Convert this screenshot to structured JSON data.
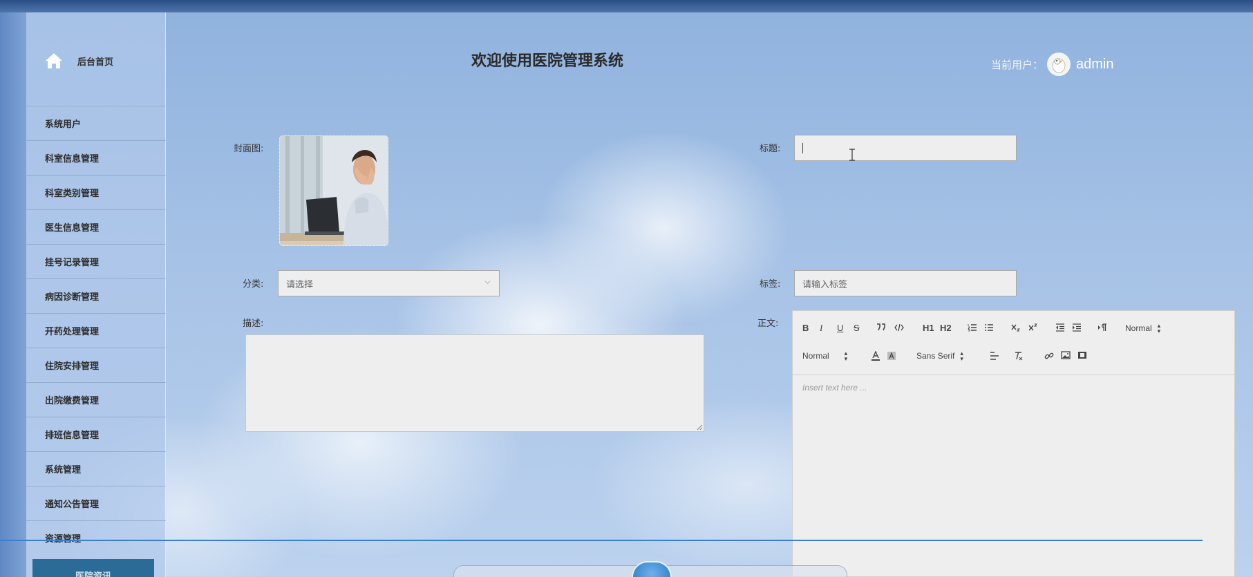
{
  "sidebar": {
    "home_label": "后台首页",
    "items": [
      {
        "label": "系统用户"
      },
      {
        "label": "科室信息管理"
      },
      {
        "label": "科室类别管理"
      },
      {
        "label": "医生信息管理"
      },
      {
        "label": "挂号记录管理"
      },
      {
        "label": "病因诊断管理"
      },
      {
        "label": "开药处理管理"
      },
      {
        "label": "住院安排管理"
      },
      {
        "label": "出院缴费管理"
      },
      {
        "label": "排班信息管理"
      },
      {
        "label": "系统管理"
      },
      {
        "label": "通知公告管理"
      },
      {
        "label": "资源管理"
      }
    ],
    "bottom_button": "医院资讯"
  },
  "header": {
    "title": "欢迎使用医院管理系统",
    "current_user_label": "当前用户：",
    "username": "admin"
  },
  "form": {
    "cover_label": "封面图:",
    "title_label": "标题:",
    "title_value": "",
    "category_label": "分类:",
    "category_placeholder": "请选择",
    "tags_label": "标签:",
    "tags_placeholder": "请输入标签",
    "description_label": "描述:",
    "description_value": "",
    "body_label": "正文:"
  },
  "editor": {
    "header_picker": "Normal",
    "size_picker": "Normal",
    "font_picker": "Sans Serif",
    "placeholder": "Insert text here ...",
    "toolbar_text": {
      "bold": "B",
      "italic": "I",
      "underline": "U",
      "strike": "S",
      "h1": "H1",
      "h2": "H2"
    }
  },
  "colors": {
    "sidebar_bottom_button": "#2a6b98",
    "topbar": "#2a4f86",
    "progress_line": "#3b7fd0"
  }
}
